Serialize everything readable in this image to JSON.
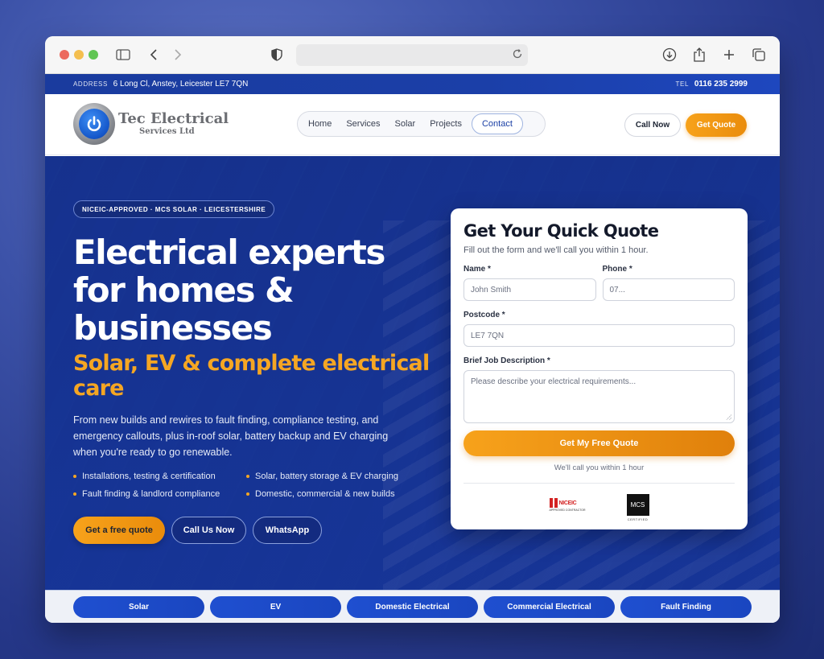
{
  "infobar": {
    "address_label": "ADDRESS",
    "address": "6 Long Cl, Anstey, Leicester LE7 7QN",
    "tel_label": "TEL",
    "tel": "0116 235 2999"
  },
  "logo": {
    "title": "Tec Electrical",
    "subtitle": "Services Ltd"
  },
  "nav": {
    "items": [
      "Home",
      "Services",
      "Solar",
      "Projects",
      "Contact"
    ],
    "active": "Contact"
  },
  "header_actions": {
    "call": "Call Now",
    "quote": "Get Quote"
  },
  "hero": {
    "badge": "NICEIC-APPROVED · MCS SOLAR · LEICESTERSHIRE",
    "title": "Electrical experts for homes & businesses",
    "subtitle": "Solar, EV & complete electrical care",
    "description": "From new builds and rewires to fault finding, compliance testing, and emergency callouts, plus in-roof solar, battery backup and EV charging when you're ready to go renewable.",
    "bullets": [
      "Installations, testing & certification",
      "Solar, battery storage & EV charging",
      "Fault finding & landlord compliance",
      "Domestic, commercial & new builds"
    ],
    "buttons": {
      "primary": "Get a free quote",
      "call": "Call Us Now",
      "whatsapp": "WhatsApp"
    }
  },
  "quote_form": {
    "title": "Get Your Quick Quote",
    "subtitle": "Fill out the form and we'll call you within 1 hour.",
    "name_label": "Name *",
    "name_placeholder": "John Smith",
    "phone_label": "Phone *",
    "phone_placeholder": "07...",
    "postcode_label": "Postcode *",
    "postcode_placeholder": "LE7 7QN",
    "desc_label": "Brief Job Description *",
    "desc_placeholder": "Please describe your electrical requirements...",
    "submit": "Get My Free Quote",
    "note": "We'll call you within 1 hour",
    "certs": {
      "niceic": "NICEIC",
      "niceic_caption": "APPROVED CONTRACTOR",
      "mcs": "MCS",
      "mcs_caption": "CERTIFIED"
    }
  },
  "services_strip": [
    "Solar",
    "EV",
    "Domestic Electrical",
    "Commercial Electrical",
    "Fault Finding"
  ],
  "colors": {
    "primary_blue": "#1a3fa5",
    "accent_orange": "#f5a623"
  }
}
